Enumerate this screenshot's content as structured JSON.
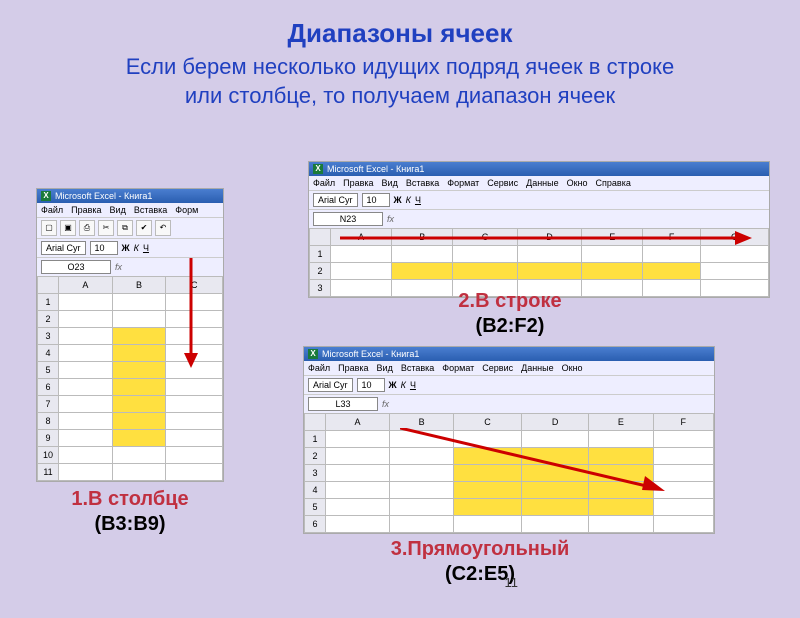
{
  "slide": {
    "title": "Диапазоны ячеек",
    "subtitle_line1": "Если берем несколько идущих подряд ячеек в строке",
    "subtitle_line2": "или столбце, то получаем диапазон ячеек",
    "page_number": "11"
  },
  "excel": {
    "app_title": "Microsoft Excel - Книга1",
    "menu": [
      "Файл",
      "Правка",
      "Вид",
      "Вставка",
      "Формат",
      "Сервис",
      "Данные",
      "Окно",
      "Справка"
    ],
    "menu_short": [
      "Файл",
      "Правка",
      "Вид",
      "Вставка",
      "Форм"
    ],
    "font_name": "Arial Cyr",
    "font_size": "10",
    "toolbar_glyphs": [
      "▢",
      "▣",
      "⎙",
      "✂",
      "⧉",
      "✔",
      "↶",
      "↷"
    ]
  },
  "example1": {
    "namebox": "O23",
    "cols": [
      "A",
      "B",
      "C"
    ],
    "rows": [
      "1",
      "2",
      "3",
      "4",
      "5",
      "6",
      "7",
      "8",
      "9",
      "10",
      "11"
    ],
    "caption_title": "1.В столбце",
    "caption_range": "(B3:B9)"
  },
  "example2": {
    "namebox": "N23",
    "cols": [
      "A",
      "B",
      "C",
      "D",
      "E",
      "F",
      "G"
    ],
    "rows": [
      "1",
      "2",
      "3"
    ],
    "caption_title": "2.В строке",
    "caption_range": "(B2:F2)"
  },
  "example3": {
    "namebox": "L33",
    "cols": [
      "A",
      "B",
      "C",
      "D",
      "E",
      "F"
    ],
    "rows": [
      "1",
      "2",
      "3",
      "4",
      "5",
      "6"
    ],
    "caption_title": "3.Прямоугольный",
    "caption_range": "(C2:E5)"
  }
}
